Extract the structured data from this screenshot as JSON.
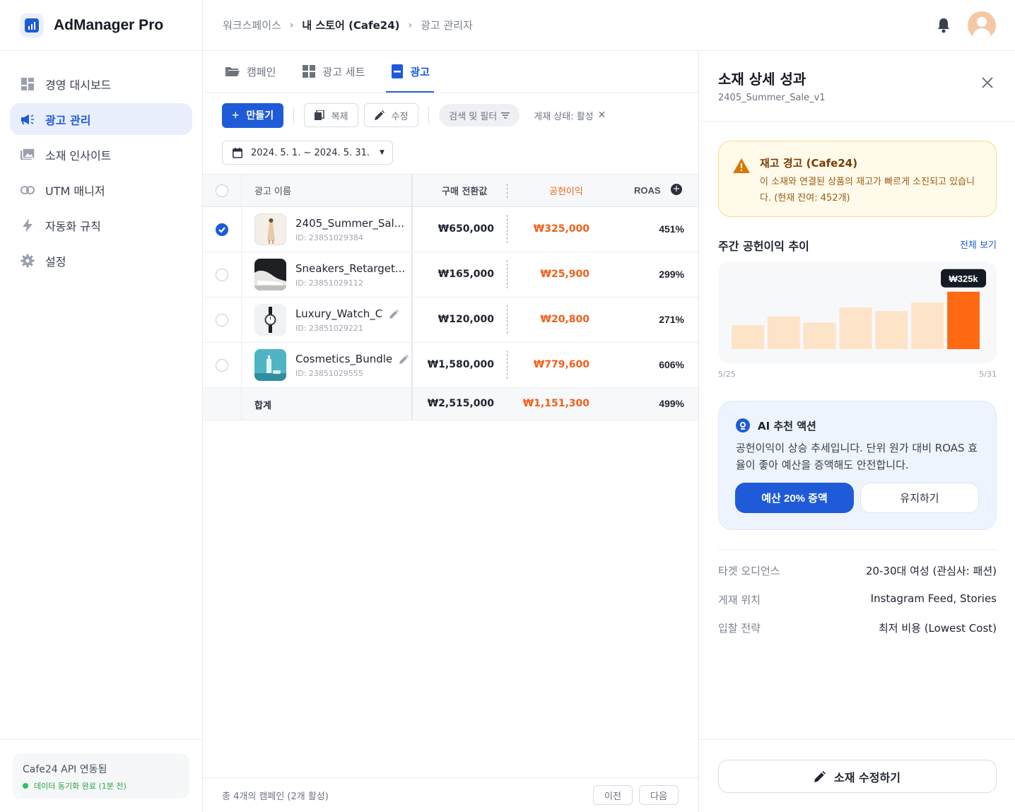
{
  "app": {
    "name": "AdManager Pro"
  },
  "breadcrumb": [
    "워크스페이스",
    "내 스토어 (Cafe24)",
    "광고 관리자"
  ],
  "sidebar": {
    "items": [
      {
        "label": "경영 대시보드",
        "icon": "dashboard-icon"
      },
      {
        "label": "광고 관리",
        "icon": "megaphone-icon",
        "active": true
      },
      {
        "label": "소재 인사이트",
        "icon": "images-icon"
      },
      {
        "label": "UTM 매니저",
        "icon": "link-icon"
      },
      {
        "label": "자동화 규칙",
        "icon": "bolt-icon"
      },
      {
        "label": "설정",
        "icon": "gear-icon"
      }
    ],
    "api_status": {
      "title": "Cafe24 API 연동됨",
      "sub": "데이터 동기화 완료 (1분 전)"
    }
  },
  "tabs": [
    {
      "label": "캠페인",
      "icon": "folder-icon"
    },
    {
      "label": "광고 세트",
      "icon": "grid-icon"
    },
    {
      "label": "광고",
      "icon": "ad-icon",
      "active": true
    }
  ],
  "toolbar": {
    "create_label": "만들기",
    "copy_label": "복제",
    "edit_label": "수정",
    "filter_label": "검색 및 필터",
    "status_filter": "게재 상태: 활성",
    "date_range": "2024. 5. 1. ~ 2024. 5. 31."
  },
  "table": {
    "headers": {
      "name": "광고 이름",
      "purchase": "구매 전환값",
      "profit": "공헌이익",
      "roas": "ROAS"
    },
    "rows": [
      {
        "name": "2405_Summer_Sal...",
        "id": "ID: 23851029384",
        "purchase": "₩650,000",
        "profit": "₩325,000",
        "roas": "451%",
        "checked": true
      },
      {
        "name": "Sneakers_Retarget...",
        "id": "ID: 23851029112",
        "purchase": "₩165,000",
        "profit": "₩25,900",
        "roas": "299%"
      },
      {
        "name": "Luxury_Watch_C",
        "id": "ID: 23851029221",
        "purchase": "₩120,000",
        "profit": "₩20,800",
        "roas": "271%"
      },
      {
        "name": "Cosmetics_Bundle",
        "id": "ID: 23851029555",
        "purchase": "₩1,580,000",
        "profit": "₩779,600",
        "roas": "606%"
      }
    ],
    "total": {
      "label": "합계",
      "purchase": "₩2,515,000",
      "profit": "₩1,151,300",
      "roas": "499%"
    }
  },
  "pager": {
    "summary": "총 4개의 캠페인 (2개 활성)",
    "prev": "이전",
    "next": "다음"
  },
  "panel": {
    "title": "소재 상세 성과",
    "subtitle": "2405_Summer_Sale_v1",
    "alert": {
      "title": "재고 경고 (Cafe24)",
      "body": "이 소재와 연결된 상품의 재고가 빠르게 소진되고 있습니다. (현재 잔여: 452개)"
    },
    "trend": {
      "title": "주간 공헌이익 추이",
      "link": "전체 보기",
      "x_start": "5/25",
      "x_end": "5/31",
      "tooltip": "₩325k"
    },
    "ai": {
      "title": "AI 추천 액션",
      "body": "공헌이익이 상승 추세입니다. 단위 원가 대비 ROAS 효율이 좋아 예산을 증액해도 안전합니다.",
      "primary": "예산 20% 증액",
      "secondary": "유지하기"
    },
    "info": [
      {
        "label": "타겟 오디언스",
        "value": "20-30대 여성 (관심사: 패션)"
      },
      {
        "label": "게재 위치",
        "value": "Instagram Feed, Stories"
      },
      {
        "label": "입찰 전략",
        "value": "최저 비용 (Lowest Cost)"
      }
    ],
    "edit_button": "소재 수정하기"
  },
  "chart_data": {
    "type": "bar",
    "categories": [
      "5/25",
      "5/26",
      "5/27",
      "5/28",
      "5/29",
      "5/30",
      "5/31"
    ],
    "values": [
      135,
      185,
      150,
      235,
      215,
      265,
      325
    ],
    "ylim": [
      0,
      400
    ],
    "grid": false,
    "highlight_index": 6,
    "colors": {
      "normal": "#fde4c8",
      "highlight": "#ff6a13"
    }
  }
}
